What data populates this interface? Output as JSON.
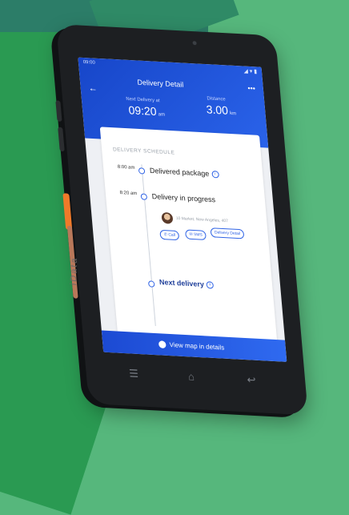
{
  "status": {
    "time": "09:00",
    "icons": "◢ ▾ ▮"
  },
  "appbar": {
    "title": "Delivery Detail",
    "back_icon": "←",
    "more_icon": "•••",
    "next_label": "Next Delivery at",
    "next_time": "09:20",
    "next_unit": "am",
    "distance_label": "Distance",
    "distance_value": "3.00",
    "distance_unit": "km"
  },
  "schedule": {
    "title": "DELIVERY SCHEDULE",
    "items": [
      {
        "time": "8:00\nam",
        "heading": "Delivered package"
      },
      {
        "time": "8:20\nam",
        "heading": "Delivery in progress",
        "sub": "10 Market, New Angeles, 407"
      },
      {
        "time": "",
        "heading": "Next delivery"
      }
    ],
    "actions": {
      "call": "Call",
      "sms": "SMS",
      "delivery_detail": "Delivery Detail"
    }
  },
  "bottom": {
    "view_map": "View map in details"
  },
  "device": {
    "brand": "iData"
  }
}
